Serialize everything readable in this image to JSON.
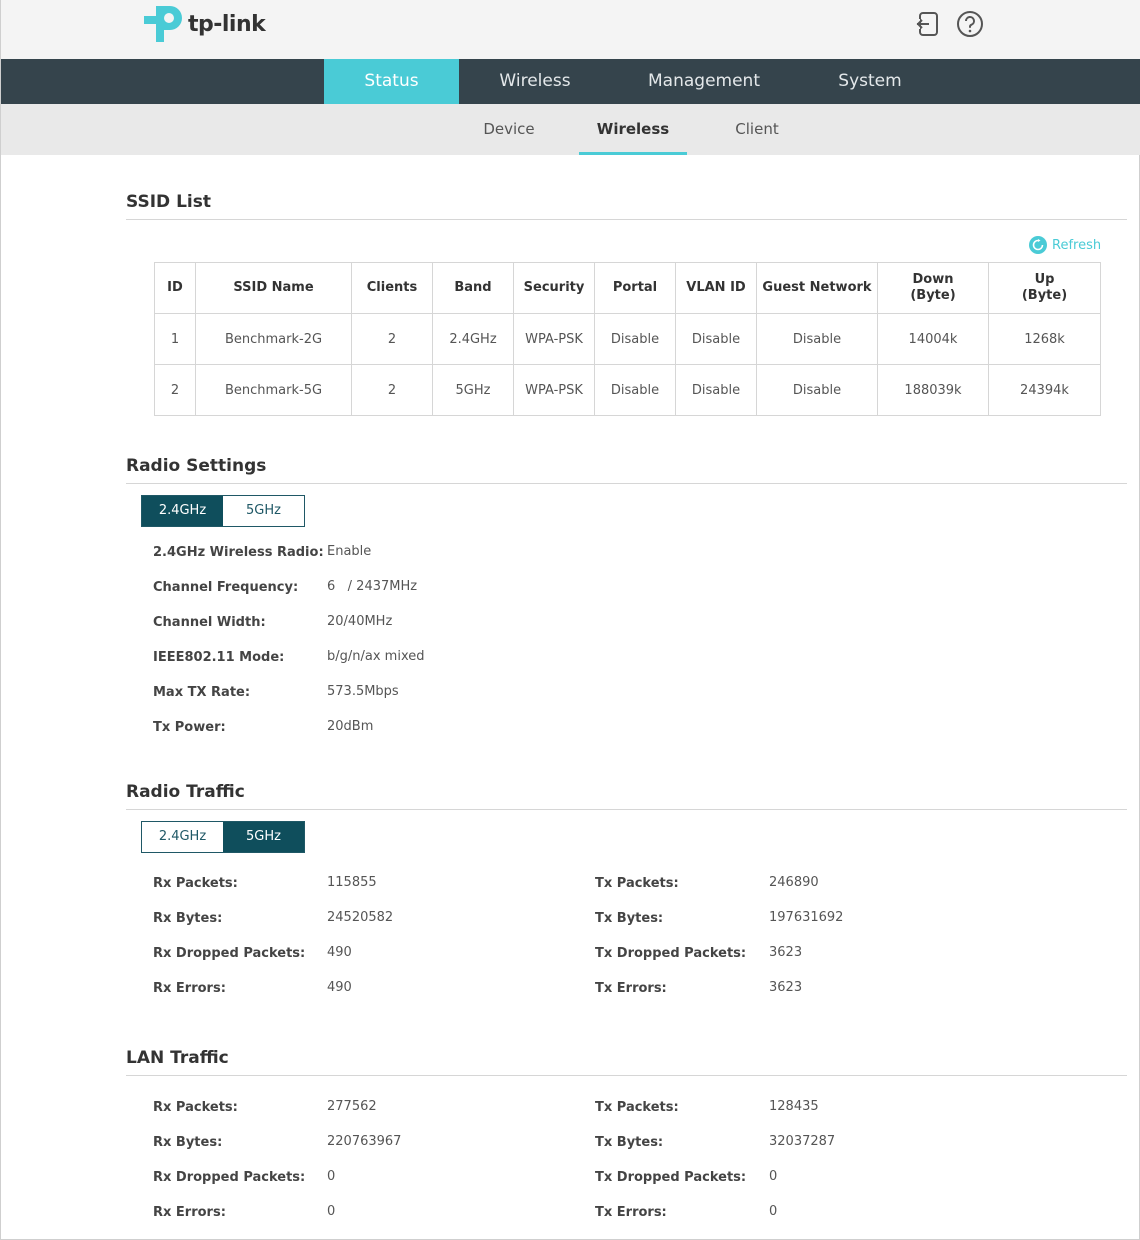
{
  "header": {
    "brand": "tp-link",
    "logout_icon": "logout-icon",
    "help_icon": "help-icon"
  },
  "mainnav": {
    "tabs": [
      {
        "label": "Status",
        "active": true
      },
      {
        "label": "Wireless",
        "active": false
      },
      {
        "label": "Management",
        "active": false
      },
      {
        "label": "System",
        "active": false
      }
    ]
  },
  "subnav": {
    "tabs": [
      {
        "label": "Device",
        "active": false
      },
      {
        "label": "Wireless",
        "active": true
      },
      {
        "label": "Client",
        "active": false
      }
    ]
  },
  "ssid_list": {
    "title": "SSID List",
    "refresh_label": "Refresh",
    "columns": [
      "ID",
      "SSID Name",
      "Clients",
      "Band",
      "Security",
      "Portal",
      "VLAN ID",
      "Guest Network",
      "Down\n(Byte)",
      "Up\n(Byte)"
    ],
    "rows": [
      [
        "1",
        "Benchmark-2G",
        "2",
        "2.4GHz",
        "WPA-PSK",
        "Disable",
        "Disable",
        "Disable",
        "14004k",
        "1268k"
      ],
      [
        "2",
        "Benchmark-5G",
        "2",
        "5GHz",
        "WPA-PSK",
        "Disable",
        "Disable",
        "Disable",
        "188039k",
        "24394k"
      ]
    ]
  },
  "radio_settings": {
    "title": "Radio Settings",
    "bands": [
      "2.4GHz",
      "5GHz"
    ],
    "selected_band": "2.4GHz",
    "fields": [
      {
        "label": "2.4GHz Wireless Radio:",
        "value": "Enable"
      },
      {
        "label": "Channel Frequency:",
        "value": "6   / 2437MHz"
      },
      {
        "label": "Channel Width:",
        "value": "20/40MHz"
      },
      {
        "label": "IEEE802.11 Mode:",
        "value": "b/g/n/ax mixed"
      },
      {
        "label": "Max TX Rate:",
        "value": "573.5Mbps"
      },
      {
        "label": "Tx Power:",
        "value": "20dBm"
      }
    ]
  },
  "radio_traffic": {
    "title": "Radio Traffic",
    "bands": [
      "2.4GHz",
      "5GHz"
    ],
    "selected_band": "5GHz",
    "rx": [
      {
        "label": "Rx Packets:",
        "value": "115855"
      },
      {
        "label": "Rx Bytes:",
        "value": "24520582"
      },
      {
        "label": "Rx Dropped Packets:",
        "value": "490"
      },
      {
        "label": "Rx Errors:",
        "value": "490"
      }
    ],
    "tx": [
      {
        "label": "Tx Packets:",
        "value": "246890"
      },
      {
        "label": "Tx Bytes:",
        "value": "197631692"
      },
      {
        "label": "Tx Dropped Packets:",
        "value": "3623"
      },
      {
        "label": "Tx Errors:",
        "value": "3623"
      }
    ]
  },
  "lan_traffic": {
    "title": "LAN Traffic",
    "rx": [
      {
        "label": "Rx Packets:",
        "value": "277562"
      },
      {
        "label": "Rx Bytes:",
        "value": "220763967"
      },
      {
        "label": "Rx Dropped Packets:",
        "value": "0"
      },
      {
        "label": "Rx Errors:",
        "value": "0"
      }
    ],
    "tx": [
      {
        "label": "Tx Packets:",
        "value": "128435"
      },
      {
        "label": "Tx Bytes:",
        "value": "32037287"
      },
      {
        "label": "Tx Dropped Packets:",
        "value": "0"
      },
      {
        "label": "Tx Errors:",
        "value": "0"
      }
    ]
  },
  "colors": {
    "accent": "#4acbd6",
    "nav_bg": "#35444c",
    "toggle_active": "#0f4e5c"
  }
}
